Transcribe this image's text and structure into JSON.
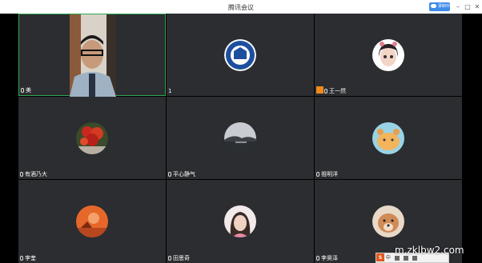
{
  "window": {
    "title": "腾讯会议",
    "cloud_label": "录制中",
    "minimize": "–",
    "maximize": "□",
    "close": "✕"
  },
  "participants": [
    {
      "name": "美",
      "mic": true,
      "video": true
    },
    {
      "name": "1",
      "mic": false,
      "video": false,
      "avatar": "school-logo"
    },
    {
      "name": "王一然",
      "mic": true,
      "host": true,
      "avatar": "cartoon-girl"
    },
    {
      "name": "有酒乃大",
      "mic": true,
      "avatar": "red-flowers"
    },
    {
      "name": "平心静气",
      "mic": true,
      "avatar": "lake-sunset"
    },
    {
      "name": "祖明洋",
      "mic": true,
      "avatar": "cartoon-animal"
    },
    {
      "name": "李奎",
      "mic": true,
      "avatar": "orange-sunset"
    },
    {
      "name": "田思奇",
      "mic": true,
      "avatar": "girl-photo"
    },
    {
      "name": "李昊泽",
      "mic": true,
      "avatar": "dog-photo"
    }
  ],
  "overlay": {
    "watermark": "m.zklbw2.com",
    "ime": "中"
  }
}
